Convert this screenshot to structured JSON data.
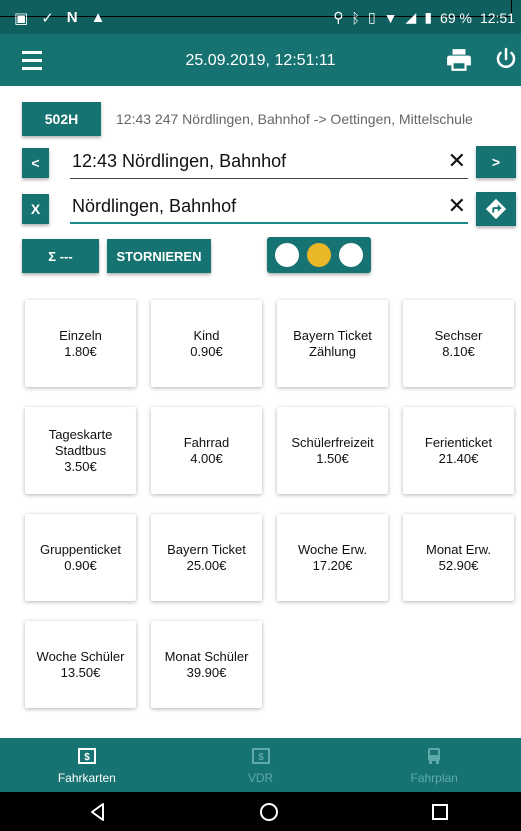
{
  "status_bar": {
    "left_icons": [
      "image-icon",
      "check-icon",
      "n-icon",
      "warning-icon"
    ],
    "battery": "69 %",
    "time": "12:51"
  },
  "app_bar": {
    "datetime": "25.09.2019, 12:51:11"
  },
  "route": {
    "line": "502H",
    "description": "12:43 247 Nördlingen, Bahnhof -> Oettingen, Mittelschule"
  },
  "stop_field": {
    "prev_label": "<",
    "value": "12:43 Nördlingen, Bahnhof",
    "clear": "✕",
    "next_label": ">"
  },
  "destination_field": {
    "clear_btn_label": "X",
    "value": "Nördlingen, Bahnhof",
    "clear": "✕"
  },
  "actions": {
    "sum_label": "Σ ---",
    "cancel_label": "STORNIEREN"
  },
  "toggle": {
    "positions": 3,
    "active_index": 1
  },
  "tickets": [
    {
      "lines": [
        "Einzeln",
        "1.80€"
      ]
    },
    {
      "lines": [
        "Kind",
        "0.90€"
      ]
    },
    {
      "lines": [
        "Bayern Ticket",
        "Zählung"
      ]
    },
    {
      "lines": [
        "Sechser",
        "8.10€"
      ]
    },
    {
      "lines": [
        "Tageskarte",
        "Stadtbus",
        "3.50€"
      ]
    },
    {
      "lines": [
        "Fahrrad",
        "4.00€"
      ]
    },
    {
      "lines": [
        "Schülerfreizeit",
        "1.50€"
      ]
    },
    {
      "lines": [
        "Ferienticket",
        "21.40€"
      ]
    },
    {
      "lines": [
        "Gruppenticket",
        "0.90€"
      ]
    },
    {
      "lines": [
        "Bayern Ticket",
        "25.00€"
      ]
    },
    {
      "lines": [
        "Woche Erw.",
        "17.20€"
      ]
    },
    {
      "lines": [
        "Monat Erw.",
        "52.90€"
      ]
    },
    {
      "lines": [
        "Woche Schüler",
        "13.50€"
      ]
    },
    {
      "lines": [
        "Monat Schüler",
        "39.90€"
      ]
    }
  ],
  "bottom_nav": [
    {
      "label": "Fahrkarten",
      "icon": "ticket-icon",
      "active": true
    },
    {
      "label": "VDR",
      "icon": "ticket-icon",
      "active": false
    },
    {
      "label": "Fahrplan",
      "icon": "bus-icon",
      "active": false
    }
  ],
  "colors": {
    "primary": "#167372",
    "status_bar": "#0f5f5e",
    "accent": "#e9b728"
  }
}
